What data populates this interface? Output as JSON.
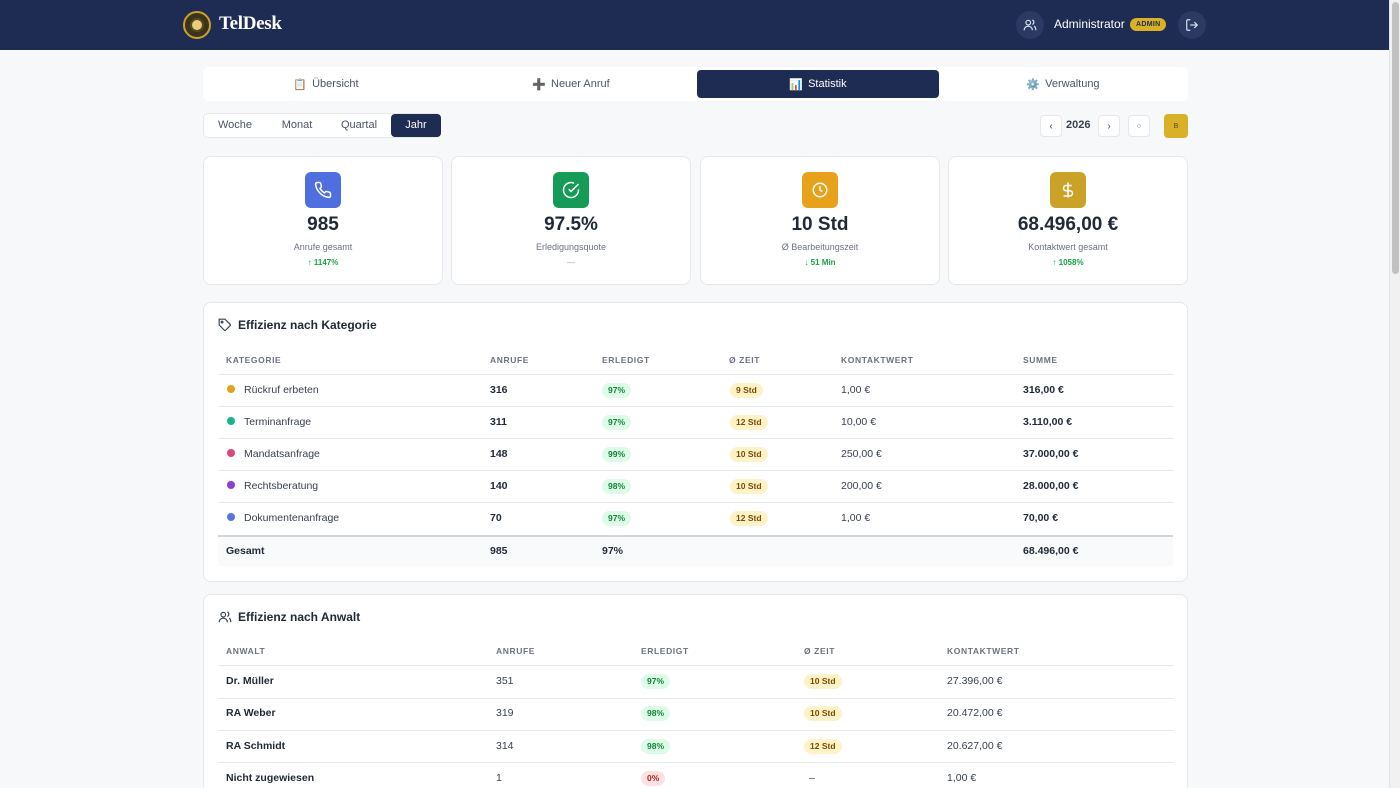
{
  "header": {
    "brand": "TelDesk",
    "username": "Administrator",
    "role_badge": "ADMIN",
    "bg_color": "#1e2b52",
    "accent_color": "#d8b126"
  },
  "nav": {
    "tabs": [
      {
        "label": "Übersicht",
        "icon": "clipboard-icon"
      },
      {
        "label": "Neuer Anruf",
        "icon": "plus-icon"
      },
      {
        "label": "Statistik",
        "icon": "chart-icon",
        "active": true
      },
      {
        "label": "Verwaltung",
        "icon": "gear-icon"
      }
    ]
  },
  "period": {
    "options": [
      "Woche",
      "Monat",
      "Quartal",
      "Jahr"
    ],
    "active": "Jahr",
    "year": "2026",
    "prev_glyph": "‹",
    "next_glyph": "›",
    "reset_glyph": "○",
    "export_glyph": "B"
  },
  "kpis": [
    {
      "value": "985",
      "label": "Anrufe gesamt",
      "trend": "↑ 1147%",
      "icon": "phone-icon",
      "color": "#4f6ee0"
    },
    {
      "value": "97.5%",
      "label": "Erledigungsquote",
      "trend": "—",
      "icon": "check-circle-icon",
      "color": "#169a58"
    },
    {
      "value": "10 Std",
      "label": "Ø Bearbeitungszeit",
      "trend": "↓ 51 Min",
      "icon": "clock-icon",
      "color": "#e8a11a"
    },
    {
      "value": "68.496,00 €",
      "label": "Kontaktwert gesamt",
      "trend": "↑ 1058%",
      "icon": "dollar-icon",
      "color": "#c9a227"
    }
  ],
  "category_table": {
    "title": "Effizienz nach Kategorie",
    "columns": [
      "KATEGORIE",
      "ANRUFE",
      "ERLEDIGT",
      "Ø ZEIT",
      "KONTAKTWERT",
      "SUMME"
    ],
    "rows": [
      {
        "name": "Rückruf erbeten",
        "color": "#e0a41b",
        "calls": "316",
        "done": "97%",
        "time": "9 Std",
        "value": "1,00 €",
        "sum": "316,00 €"
      },
      {
        "name": "Terminanfrage",
        "color": "#17b58a",
        "calls": "311",
        "done": "97%",
        "time": "12 Std",
        "value": "10,00 €",
        "sum": "3.110,00 €"
      },
      {
        "name": "Mandatsanfrage",
        "color": "#e0447f",
        "calls": "148",
        "done": "99%",
        "time": "10 Std",
        "value": "250,00 €",
        "sum": "37.000,00 €"
      },
      {
        "name": "Rechtsberatung",
        "color": "#8b3fd9",
        "calls": "140",
        "done": "98%",
        "time": "10 Std",
        "value": "200,00 €",
        "sum": "28.000,00 €"
      },
      {
        "name": "Dokumentenanfrage",
        "color": "#5b72e3",
        "calls": "70",
        "done": "97%",
        "time": "12 Std",
        "value": "1,00 €",
        "sum": "70,00 €"
      }
    ],
    "total": {
      "label": "Gesamt",
      "calls": "985",
      "done": "97%",
      "sum": "68.496,00 €"
    }
  },
  "lawyer_table": {
    "title": "Effizienz nach Anwalt",
    "columns": [
      "ANWALT",
      "ANRUFE",
      "ERLEDIGT",
      "Ø ZEIT",
      "KONTAKTWERT"
    ],
    "rows": [
      {
        "name": "Dr. Müller",
        "calls": "351",
        "done": "97%",
        "time": "10 Std",
        "value": "27.396,00 €"
      },
      {
        "name": "RA Weber",
        "calls": "319",
        "done": "98%",
        "time": "10 Std",
        "value": "20.472,00 €"
      },
      {
        "name": "RA Schmidt",
        "calls": "314",
        "done": "98%",
        "time": "12 Std",
        "value": "20.627,00 €"
      },
      {
        "name": "Nicht zugewiesen",
        "calls": "1",
        "done": "0%",
        "time": "–",
        "value": "1,00 €"
      }
    ]
  }
}
